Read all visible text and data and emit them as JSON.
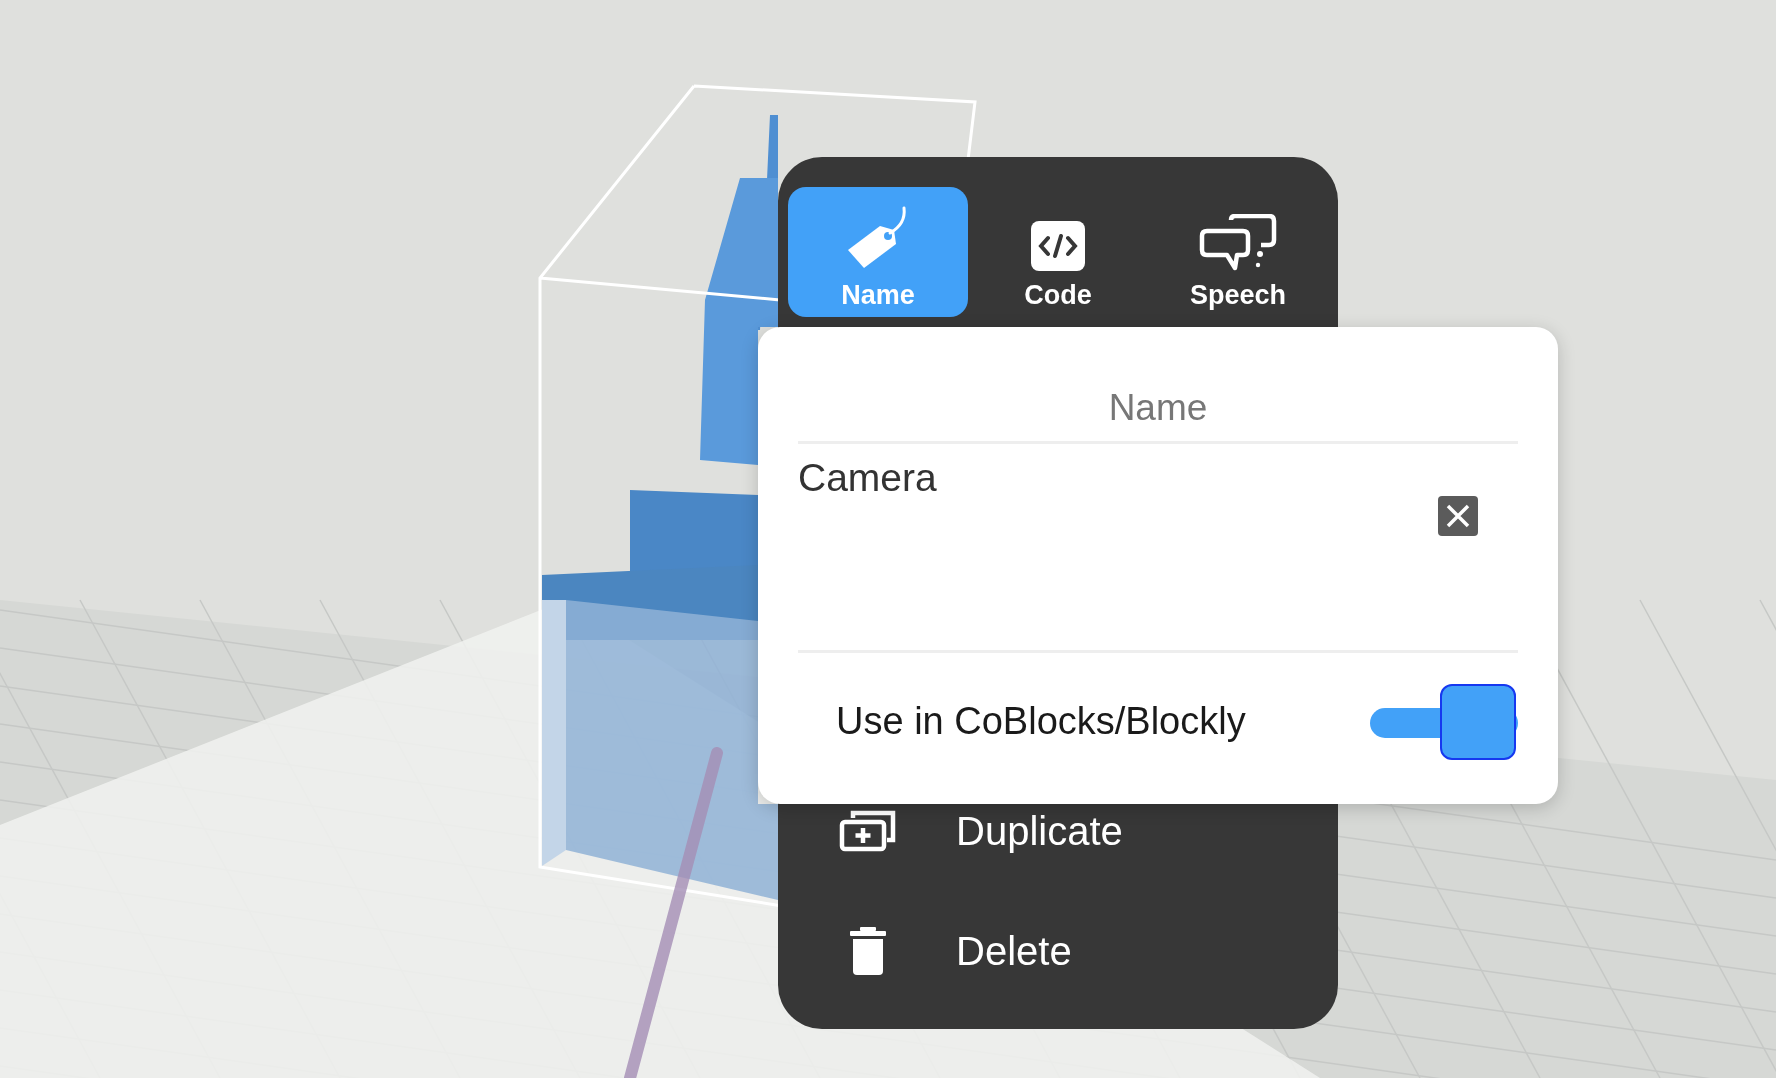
{
  "tabs": [
    {
      "label": "Name",
      "selected": true
    },
    {
      "label": "Code",
      "selected": false
    },
    {
      "label": "Speech",
      "selected": false
    }
  ],
  "name_panel": {
    "title": "Name",
    "value": "Camera",
    "toggle": {
      "label": "Use in CoBlocks/Blockly",
      "on": true
    }
  },
  "menu_items": [
    {
      "label": "Duplicate"
    },
    {
      "label": "Delete"
    }
  ]
}
